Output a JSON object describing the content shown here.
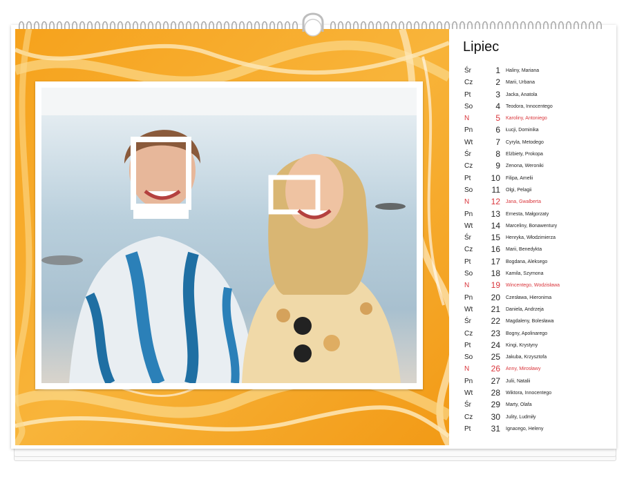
{
  "calendar": {
    "month": "Lipiec",
    "days": [
      {
        "weekday": "Śr",
        "day": "1",
        "names": "Haliny, Mariana",
        "sunday": false
      },
      {
        "weekday": "Cz",
        "day": "2",
        "names": "Marii, Urbana",
        "sunday": false
      },
      {
        "weekday": "Pt",
        "day": "3",
        "names": "Jacka, Anatola",
        "sunday": false
      },
      {
        "weekday": "So",
        "day": "4",
        "names": "Teodora, Innocentego",
        "sunday": false
      },
      {
        "weekday": "N",
        "day": "5",
        "names": "Karoliny, Antoniego",
        "sunday": true
      },
      {
        "weekday": "Pn",
        "day": "6",
        "names": "Łucji, Dominika",
        "sunday": false
      },
      {
        "weekday": "Wt",
        "day": "7",
        "names": "Cyryla, Metodego",
        "sunday": false
      },
      {
        "weekday": "Śr",
        "day": "8",
        "names": "Elżbiety, Prokopa",
        "sunday": false
      },
      {
        "weekday": "Cz",
        "day": "9",
        "names": "Zenona, Weroniki",
        "sunday": false
      },
      {
        "weekday": "Pt",
        "day": "10",
        "names": "Filipa, Amelii",
        "sunday": false
      },
      {
        "weekday": "So",
        "day": "11",
        "names": "Olgi, Pelagii",
        "sunday": false
      },
      {
        "weekday": "N",
        "day": "12",
        "names": "Jana, Gwalberta",
        "sunday": true
      },
      {
        "weekday": "Pn",
        "day": "13",
        "names": "Ernesta, Małgorzaty",
        "sunday": false
      },
      {
        "weekday": "Wt",
        "day": "14",
        "names": "Marceliny, Bonawentury",
        "sunday": false
      },
      {
        "weekday": "Śr",
        "day": "15",
        "names": "Henryka, Włodzimierza",
        "sunday": false
      },
      {
        "weekday": "Cz",
        "day": "16",
        "names": "Marii, Benedykta",
        "sunday": false
      },
      {
        "weekday": "Pt",
        "day": "17",
        "names": "Bogdana, Aleksego",
        "sunday": false
      },
      {
        "weekday": "So",
        "day": "18",
        "names": "Kamila, Szymona",
        "sunday": false
      },
      {
        "weekday": "N",
        "day": "19",
        "names": "Wincentego, Wodzisława",
        "sunday": true
      },
      {
        "weekday": "Pn",
        "day": "20",
        "names": "Czesława, Hieronima",
        "sunday": false
      },
      {
        "weekday": "Wt",
        "day": "21",
        "names": "Daniela, Andrzeja",
        "sunday": false
      },
      {
        "weekday": "Śr",
        "day": "22",
        "names": "Magdaleny, Bolesława",
        "sunday": false
      },
      {
        "weekday": "Cz",
        "day": "23",
        "names": "Bogny, Apolinarego",
        "sunday": false
      },
      {
        "weekday": "Pt",
        "day": "24",
        "names": "Kingi, Krystyny",
        "sunday": false
      },
      {
        "weekday": "So",
        "day": "25",
        "names": "Jakuba, Krzysztofa",
        "sunday": false
      },
      {
        "weekday": "N",
        "day": "26",
        "names": "Anny, Mirosławy",
        "sunday": true
      },
      {
        "weekday": "Pn",
        "day": "27",
        "names": "Julii, Natalii",
        "sunday": false
      },
      {
        "weekday": "Wt",
        "day": "28",
        "names": "Wiktora, Innocentego",
        "sunday": false
      },
      {
        "weekday": "Śr",
        "day": "29",
        "names": "Marty, Olafa",
        "sunday": false
      },
      {
        "weekday": "Cz",
        "day": "30",
        "names": "Julity, Ludmiły",
        "sunday": false
      },
      {
        "weekday": "Pt",
        "day": "31",
        "names": "Ignacego, Heleny",
        "sunday": false
      }
    ]
  },
  "colors": {
    "sunday": "#d9343a",
    "marble_orange": "#f5a623",
    "marble_light": "#fbd98a"
  },
  "icons": {
    "binding": "wire-binding-icon",
    "hanger": "hanger-hook-icon"
  }
}
